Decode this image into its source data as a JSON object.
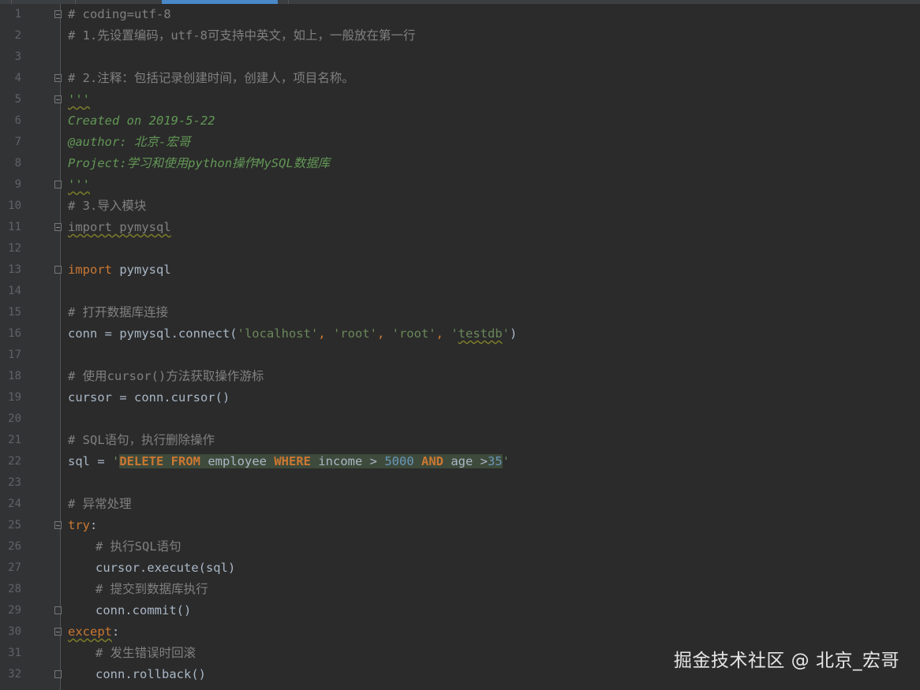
{
  "watermark": "掘金技术社区 @ 北京_宏哥",
  "lines": [
    {
      "n": "1",
      "parts": [
        {
          "t": "# coding=utf-8",
          "c": "cm"
        }
      ]
    },
    {
      "n": "2",
      "parts": [
        {
          "t": "# 1.先设置编码，utf-8可支持中英文，如上，一般放在第一行",
          "c": "cm"
        }
      ]
    },
    {
      "n": "3",
      "parts": []
    },
    {
      "n": "4",
      "parts": [
        {
          "t": "# 2.注释：包括记录创建时间，创建人，项目名称。",
          "c": "cm"
        }
      ]
    },
    {
      "n": "5",
      "parts": [
        {
          "t": "'''",
          "c": "doc wavy"
        }
      ]
    },
    {
      "n": "6",
      "parts": [
        {
          "t": "Created on 2019-5-22",
          "c": "doc"
        }
      ]
    },
    {
      "n": "7",
      "parts": [
        {
          "t": "@author: 北京-宏哥",
          "c": "doc"
        }
      ]
    },
    {
      "n": "8",
      "parts": [
        {
          "t": "Project:学习和使用python操作MySQL数据库",
          "c": "doc"
        }
      ]
    },
    {
      "n": "9",
      "parts": [
        {
          "t": "'''",
          "c": "doc wavy"
        }
      ]
    },
    {
      "n": "10",
      "parts": [
        {
          "t": "# 3.导入模块",
          "c": "cm"
        }
      ]
    },
    {
      "n": "11",
      "parts": [
        {
          "t": "import pymysql",
          "c": "cm wavy"
        }
      ]
    },
    {
      "n": "12",
      "parts": []
    },
    {
      "n": "13",
      "parts": [
        {
          "t": "import",
          "c": "kw"
        },
        {
          "t": " pymysql",
          "c": ""
        }
      ]
    },
    {
      "n": "14",
      "parts": []
    },
    {
      "n": "15",
      "parts": [
        {
          "t": "# 打开数据库连接",
          "c": "cm"
        }
      ]
    },
    {
      "n": "16",
      "parts": [
        {
          "t": "conn = pymysql.connect(",
          "c": ""
        },
        {
          "t": "'localhost'",
          "c": "str"
        },
        {
          "t": ", ",
          "c": "kw"
        },
        {
          "t": "'root'",
          "c": "str"
        },
        {
          "t": ", ",
          "c": "kw"
        },
        {
          "t": "'root'",
          "c": "str"
        },
        {
          "t": ", ",
          "c": "kw"
        },
        {
          "t": "'",
          "c": "str"
        },
        {
          "t": "testdb",
          "c": "str wavy"
        },
        {
          "t": "'",
          "c": "str"
        },
        {
          "t": ")",
          "c": ""
        }
      ]
    },
    {
      "n": "17",
      "parts": []
    },
    {
      "n": "18",
      "parts": [
        {
          "t": "# 使用cursor()方法获取操作游标",
          "c": "cm"
        }
      ]
    },
    {
      "n": "19",
      "parts": [
        {
          "t": "cursor = conn.cursor()",
          "c": ""
        }
      ]
    },
    {
      "n": "20",
      "parts": []
    },
    {
      "n": "21",
      "parts": [
        {
          "t": "# SQL语句，执行删除操作",
          "c": "cm"
        }
      ]
    },
    {
      "n": "22",
      "parts": [
        {
          "t": "sql = ",
          "c": ""
        },
        {
          "t": "'",
          "c": "str"
        },
        {
          "t": "DELETE FROM",
          "c": "sqlbg sqlkw"
        },
        {
          "t": " employee ",
          "c": "sqlbg sqlid"
        },
        {
          "t": "WHERE",
          "c": "sqlbg sqlkw"
        },
        {
          "t": " income ",
          "c": "sqlbg sqlid"
        },
        {
          "t": ">",
          "c": "sqlbg sqlop"
        },
        {
          "t": " 5000 ",
          "c": "sqlbg num"
        },
        {
          "t": "AND",
          "c": "sqlbg sqlkw"
        },
        {
          "t": " age ",
          "c": "sqlbg sqlid"
        },
        {
          "t": ">",
          "c": "sqlbg sqlop"
        },
        {
          "t": "35",
          "c": "sqlbg num"
        },
        {
          "t": "'",
          "c": "str"
        }
      ]
    },
    {
      "n": "23",
      "parts": []
    },
    {
      "n": "24",
      "parts": [
        {
          "t": "# 异常处理",
          "c": "cm"
        }
      ]
    },
    {
      "n": "25",
      "parts": [
        {
          "t": "try",
          "c": "kw"
        },
        {
          "t": ":",
          "c": ""
        }
      ]
    },
    {
      "n": "26",
      "parts": [
        {
          "t": "# 执行SQL语句",
          "c": "cm",
          "indent": 1
        }
      ]
    },
    {
      "n": "27",
      "parts": [
        {
          "t": "cursor.execute(sql)",
          "c": "",
          "indent": 1
        }
      ]
    },
    {
      "n": "28",
      "parts": [
        {
          "t": "# 提交到数据库执行",
          "c": "cm",
          "indent": 1
        }
      ]
    },
    {
      "n": "29",
      "parts": [
        {
          "t": "conn.commit()",
          "c": "",
          "indent": 1
        }
      ]
    },
    {
      "n": "30",
      "parts": [
        {
          "t": "except",
          "c": "kw wavy"
        },
        {
          "t": ":",
          "c": ""
        }
      ]
    },
    {
      "n": "31",
      "parts": [
        {
          "t": "# 发生错误时回滚",
          "c": "cm",
          "indent": 1
        }
      ]
    },
    {
      "n": "32",
      "parts": [
        {
          "t": "conn.rollback()",
          "c": "",
          "indent": 1
        }
      ]
    }
  ]
}
